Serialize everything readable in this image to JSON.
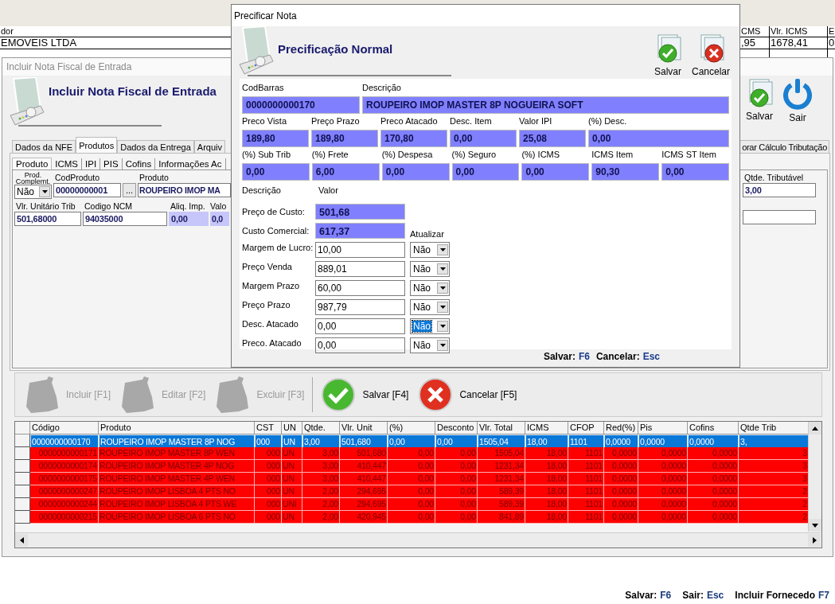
{
  "background_grid": {
    "columns": [
      {
        "header": "dor",
        "value": "EMOVEIS LTDA"
      },
      {
        "header": "CMS",
        "value": ",95"
      },
      {
        "header": "Vlr. ICMS",
        "value": "1678,41"
      },
      {
        "header": "E",
        "value": "0"
      }
    ]
  },
  "main_window": {
    "title": "Incluir Nota Fiscal de Entrada",
    "heading": "Incluir Nota Fiscal de Entrada",
    "buttons": [
      {
        "kind": "save",
        "label": "Salvar"
      },
      {
        "kind": "exit",
        "label": "Sair"
      }
    ],
    "tabs": [
      {
        "label": "Dados da NFE",
        "selected": false
      },
      {
        "label": "Produtos",
        "selected": true
      },
      {
        "label": "Dados da Entrega",
        "selected": false
      },
      {
        "label": "Arquiv",
        "selected": false
      },
      {
        "label": "orar Cálculo Tributação",
        "selected": false
      }
    ],
    "subtabs": [
      {
        "label": "Produto",
        "selected": true
      },
      {
        "label": "ICMS",
        "selected": false
      },
      {
        "label": "IPI",
        "selected": false
      },
      {
        "label": "PIS",
        "selected": false
      },
      {
        "label": "Cofins",
        "selected": false
      },
      {
        "label": "Informações Ac",
        "selected": false
      }
    ],
    "form_rows": [
      [
        {
          "kind": "select",
          "label": "Prod. Complemt.",
          "value": "Não"
        },
        {
          "kind": "text",
          "label": "CodProduto",
          "value": "00000000001"
        },
        {
          "kind": "button",
          "value": "..."
        },
        {
          "kind": "text",
          "label": "Produto",
          "value": "ROUPEIRO IMOP MA"
        }
      ],
      [
        {
          "kind": "text",
          "label": "Vlr. Unitário Trib",
          "value": "501,68000"
        },
        {
          "kind": "text",
          "label": "Codigo NCM",
          "value": "94035000"
        },
        {
          "kind": "calc",
          "label": "Aliq. Imp.",
          "value": "0,00"
        },
        {
          "kind": "calc",
          "label": "Valo",
          "value": "0,0"
        }
      ]
    ],
    "side_fields": [
      {
        "kind": "text",
        "label": "Qtde. Tributável",
        "value": "3,00"
      },
      {
        "kind": "blank"
      }
    ],
    "toolbar": [
      {
        "kind": "add",
        "label": "Incluir [F1]",
        "disabled": true
      },
      {
        "kind": "edit",
        "label": "Editar [F2]",
        "disabled": true
      },
      {
        "kind": "delete",
        "label": "Excluir [F3]",
        "disabled": true
      },
      {
        "kind": "save",
        "label": "Salvar [F4]",
        "disabled": false
      },
      {
        "kind": "cancel",
        "label": "Cancelar [F5]",
        "disabled": false
      }
    ],
    "table": {
      "columns": [
        {
          "label": "Código",
          "kind": "number"
        },
        {
          "label": "Produto",
          "kind": "text"
        },
        {
          "label": "CST",
          "kind": "number"
        },
        {
          "label": "UN",
          "kind": "text"
        },
        {
          "label": "Qtde.",
          "kind": "number"
        },
        {
          "label": "Vlr. Unit",
          "kind": "number"
        },
        {
          "label": "(%)",
          "kind": "number"
        },
        {
          "label": "Desconto",
          "kind": "number"
        },
        {
          "label": "Vlr. Total",
          "kind": "number"
        },
        {
          "label": "ICMS",
          "kind": "number"
        },
        {
          "label": "CFOP",
          "kind": "number"
        },
        {
          "label": "Red(%)",
          "kind": "number"
        },
        {
          "label": "Pis",
          "kind": "number"
        },
        {
          "label": "Cofins",
          "kind": "number"
        },
        {
          "label": "Qtde Trib",
          "kind": "number"
        }
      ],
      "rows": [
        {
          "selected": true,
          "cells": [
            "0000000000170",
            "ROUPEIRO IMOP MASTER 8P NOG",
            "000",
            "UN",
            "3,00",
            "501,680",
            "0,00",
            "0,00",
            "1505,04",
            "18,00",
            "1101",
            "0,0000",
            "0,0000",
            "0,0000",
            "3,"
          ]
        },
        {
          "selected": false,
          "cells": [
            "0000000000171",
            "ROUPEIRO IMOP MASTER 8P WEN",
            "000",
            "UN",
            "3,00",
            "501,680",
            "0,00",
            "0,00",
            "1505,04",
            "18,00",
            "1101",
            "0,0000",
            "0,0000",
            "0,0000",
            "3"
          ]
        },
        {
          "selected": false,
          "cells": [
            "0000000000174",
            "ROUPEIRO IMOP MASTER 4P NOG",
            "000",
            "UN",
            "3,00",
            "410,447",
            "0,00",
            "0,00",
            "1231,34",
            "18,00",
            "1101",
            "0,0000",
            "0,0000",
            "0,0000",
            "3"
          ]
        },
        {
          "selected": false,
          "cells": [
            "0000000000175",
            "ROUPEIRO IMOP MASTER 4P WEN",
            "000",
            "UN",
            "3,00",
            "410,447",
            "0,00",
            "0,00",
            "1231,34",
            "18,00",
            "1101",
            "0,0000",
            "0,0000",
            "0,0000",
            "3"
          ]
        },
        {
          "selected": false,
          "cells": [
            "0000000000247",
            "ROUPEIRO IMOP LISBOA 4 PTS NO",
            "000",
            "UN",
            "2,00",
            "294,695",
            "0,00",
            "0,00",
            "589,39",
            "18,00",
            "1101",
            "0,0000",
            "0,0000",
            "0,0000",
            "2"
          ]
        },
        {
          "selected": false,
          "cells": [
            "0000000000244",
            "ROUPEIRO IMOP LISBOA 4 PTS WE",
            "000",
            "UNI",
            "2,00",
            "294,695",
            "0,00",
            "0,00",
            "589,39",
            "18,00",
            "1101",
            "0,0000",
            "0,0000",
            "0,0000",
            "2"
          ]
        },
        {
          "selected": false,
          "cells": [
            "0000000000215",
            "ROUPEIRO IMOP LISBOA 6 PTS NO",
            "000",
            "UN",
            "2,00",
            "420,945",
            "0,00",
            "0,00",
            "841,89",
            "18,00",
            "1101",
            "0,0000",
            "0,0000",
            "0,0000",
            "2"
          ]
        }
      ]
    }
  },
  "status_bar": [
    {
      "label": "Salvar:",
      "key": "F6"
    },
    {
      "label": "Sair:",
      "key": "Esc"
    },
    {
      "label": "Incluir Fornecedo",
      "key": "F7"
    }
  ],
  "dialog": {
    "title": "Precificar Nota",
    "heading": "Precificação Normal",
    "buttons": [
      {
        "kind": "save",
        "label": "Salvar"
      },
      {
        "kind": "cancel",
        "label": "Cancelar"
      }
    ],
    "field_rows": [
      [
        {
          "label": "CodBarras",
          "value": "0000000000170"
        },
        {
          "label": "Descrição",
          "value": "ROUPEIRO IMOP MASTER 8P NOGUEIRA SOFT"
        }
      ],
      [
        {
          "label": "Preco Vista",
          "value": "189,80"
        },
        {
          "label": "Preço Prazo",
          "value": "189,80"
        },
        {
          "label": "Preco Atacado",
          "value": "170,80"
        },
        {
          "label": "Desc. Item",
          "value": "0,00"
        },
        {
          "label": "Valor IPI",
          "value": "25,08"
        },
        {
          "label": "(%) Desc.",
          "value": "0,00"
        }
      ],
      [
        {
          "label": "(%) Sub Trib",
          "value": "0,00"
        },
        {
          "label": "(%) Frete",
          "value": "6,00"
        },
        {
          "label": "(%) Despesa",
          "value": "0,00"
        },
        {
          "label": "(%) Seguro",
          "value": "0,00"
        },
        {
          "label": "(%) ICMS",
          "value": "0,00"
        },
        {
          "label": "ICMS Item",
          "value": "90,30"
        },
        {
          "label": "ICMS ST Item",
          "value": "0,00"
        }
      ]
    ],
    "pricing": {
      "label_header": "Descrição",
      "value_header": "Valor",
      "update_header": "Atualizar",
      "costs": [
        {
          "label": "Preço de Custo:",
          "value": "501,68"
        },
        {
          "label": "Custo Comercial:",
          "value": "617,37"
        }
      ],
      "rows": [
        {
          "label": "Margem de Lucro:",
          "value": "10,00",
          "update": "Não",
          "focused": false
        },
        {
          "label": "Preço Venda",
          "value": "889,01",
          "update": "Não",
          "focused": false
        },
        {
          "label": "Margem Prazo",
          "value": "60,00",
          "update": "Não",
          "focused": false
        },
        {
          "label": "Preço Prazo",
          "value": "987,79",
          "update": "Não",
          "focused": false
        },
        {
          "label": "Desc. Atacado",
          "value": "0,00",
          "update": "Não",
          "focused": true
        },
        {
          "label": "Preco. Atacado",
          "value": "0,00",
          "update": "Não",
          "focused": false
        }
      ]
    },
    "shortcuts": [
      {
        "label": "Salvar:",
        "key": "F6"
      },
      {
        "label": "Cancelar:",
        "key": "Esc"
      }
    ]
  }
}
